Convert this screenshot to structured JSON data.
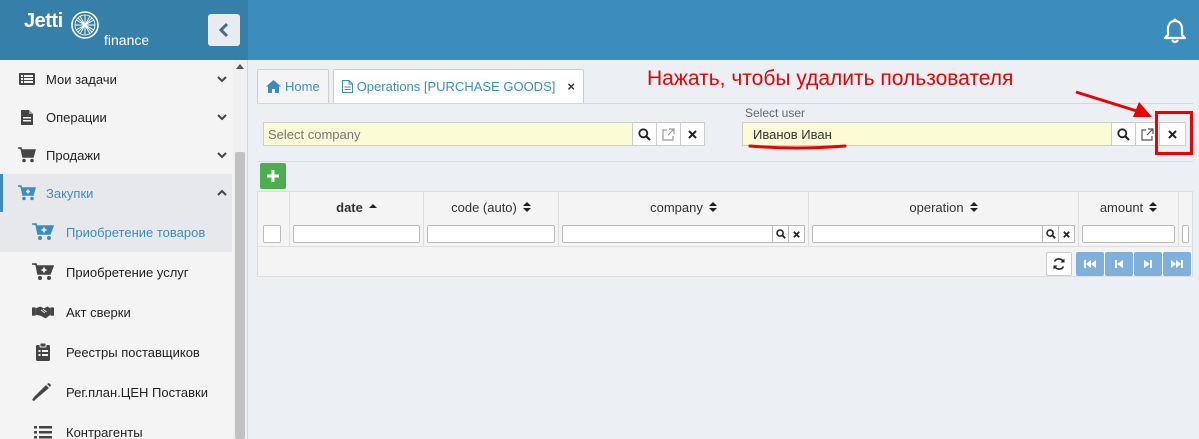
{
  "app": {
    "brand_name": "Jetti",
    "brand_sub": "finance"
  },
  "sidebar": {
    "items": [
      {
        "label": "Мои задачи",
        "icon": "list-icon"
      },
      {
        "label": "Операции",
        "icon": "file-icon"
      },
      {
        "label": "Продажи",
        "icon": "cart-icon"
      },
      {
        "label": "Закупки",
        "icon": "cart-plus-icon"
      }
    ],
    "subitems": [
      {
        "label": "Приобретение товаров",
        "icon": "cart-plus-icon"
      },
      {
        "label": "Приобретение услуг",
        "icon": "cart-plus-icon"
      },
      {
        "label": "Акт сверки",
        "icon": "handshake-icon"
      },
      {
        "label": "Реестры поставщиков",
        "icon": "clipboard-icon"
      },
      {
        "label": "Рег.план.ЦЕН Поставки",
        "icon": "pencil-icon"
      },
      {
        "label": "Контрагенты",
        "icon": "list-icon"
      }
    ]
  },
  "tabs": [
    {
      "label": "Home",
      "icon": "home-icon"
    },
    {
      "label": "Operations [PURCHASE GOODS]",
      "icon": "document-icon",
      "close": "×"
    }
  ],
  "company_select": {
    "placeholder": "Select company",
    "value": ""
  },
  "user_select": {
    "label": "Select user",
    "value": "Иванов Иван"
  },
  "annotation": {
    "text": "Нажать, чтобы удалить пользователя"
  },
  "grid": {
    "add_label": "+",
    "columns": [
      "date",
      "code (auto)",
      "company",
      "operation",
      "amount"
    ]
  },
  "colors": {
    "header": "#3c8dbc",
    "header_dark": "#367fa9",
    "accent": "#3c8dbc",
    "field_bg": "#fbfbd6",
    "annotation": "#ee0000",
    "add_button": "#4cae4c"
  }
}
